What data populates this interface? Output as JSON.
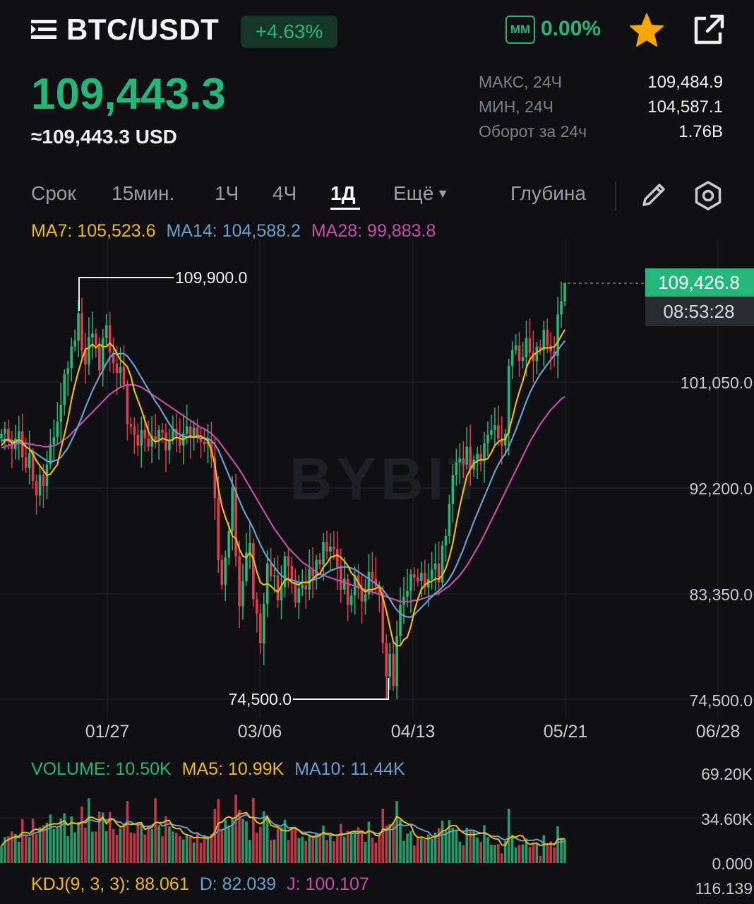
{
  "header": {
    "pair": "BTC/USDT",
    "change_pct": "+4.63%",
    "mm_label": "MM",
    "mm_value": "0.00%",
    "menu_icon": "menu-icon",
    "favorite_icon": "star-icon",
    "share_icon": "share-icon",
    "accent_green": "#25b77a",
    "star_color": "#f7a600"
  },
  "price": {
    "last": "109,443.3",
    "usd": "≈109,443.3 USD"
  },
  "stats": [
    {
      "label": "МАКС, 24Ч",
      "value": "109,484.9"
    },
    {
      "label": "МИН, 24Ч",
      "value": "104,587.1"
    },
    {
      "label": "Оборот за 24ч",
      "value": "1.76B"
    }
  ],
  "tabs": [
    {
      "label": "Срок",
      "active": false
    },
    {
      "label": "15мин.",
      "active": false
    },
    {
      "label": "1Ч",
      "active": false
    },
    {
      "label": "4Ч",
      "active": false
    },
    {
      "label": "1Д",
      "active": true
    },
    {
      "label": "Ещё",
      "active": false
    },
    {
      "label": "Глубина",
      "active": false
    }
  ],
  "ma_legend": {
    "ma7": "MA7: 105,523.6",
    "ma14": "MA14: 104,588.2",
    "ma28": "MA28: 99,883.8",
    "ma7_color": "#f0b90b",
    "ma14_color": "#6a9fc9",
    "ma28_color": "#c34fa8"
  },
  "volume_legend": {
    "volume": "VOLUME: 10.50K",
    "ma5": "MA5: 10.99K",
    "ma10": "MA10: 11.44K"
  },
  "kdj_legend": {
    "k": "KDJ(9, 3, 3): 88.061",
    "d": "D: 82.039",
    "j": "J: 100.107"
  },
  "watermark": "BYBIT",
  "chart_data": {
    "type": "candlestick",
    "y_ticks": [
      "101,050.0",
      "92,200.0",
      "83,350.0",
      "74,500.0"
    ],
    "y_range": [
      74500,
      109900
    ],
    "x_ticks": [
      "01/27",
      "03/06",
      "04/13",
      "05/21",
      "06/28"
    ],
    "high_marker": "109,900.0",
    "low_marker": "74,500.0",
    "current_price": "109,426.8",
    "countdown": "08:53:28",
    "volume_ticks": [
      "69.20K",
      "34.60K",
      "0.000"
    ],
    "kdj_tick": "116.139",
    "up_color": "#25b77a",
    "down_color": "#e03e4d",
    "close_series": [
      96800,
      97200,
      96100,
      95500,
      96400,
      97000,
      94800,
      93900,
      95200,
      92800,
      91600,
      93300,
      92400,
      94200,
      95900,
      96500,
      97800,
      99200,
      101800,
      102300,
      104100,
      104600,
      106900,
      103800,
      102600,
      104900,
      105200,
      104300,
      102100,
      104800,
      105900,
      103600,
      102700,
      101900,
      102400,
      100900,
      97600,
      97400,
      96700,
      95800,
      97100,
      96400,
      95700,
      96600,
      96200,
      97100,
      96900,
      95400,
      96300,
      97200,
      96600,
      95800,
      96800,
      97400,
      96500,
      97300,
      96400,
      96100,
      95900,
      96300,
      94800,
      91400,
      86200,
      84100,
      86400,
      88600,
      92300,
      86500,
      82300,
      84400,
      86800,
      87600,
      82900,
      81700,
      79200,
      82500,
      85900,
      84800,
      84900,
      82800,
      83900,
      86500,
      85700,
      84500,
      82600,
      83800,
      84100,
      83700,
      85400,
      84800,
      86200,
      85800,
      87700,
      86900,
      87300,
      87100,
      85500,
      83700,
      84600,
      82400,
      83200,
      84900,
      83800,
      82700,
      83300,
      85200,
      84600,
      84000,
      83400,
      79200,
      76400,
      78300,
      75600,
      79800,
      82400,
      83100,
      83600,
      85000,
      84700,
      84400,
      85100,
      83900,
      84600,
      85400,
      85900,
      84300,
      87400,
      88200,
      90900,
      93300,
      94400,
      94700,
      94200,
      95700,
      93800,
      94600,
      95100,
      94500,
      96000,
      96700,
      97100,
      97500,
      96400,
      95800,
      96800,
      102500,
      103800,
      104200,
      102900,
      103200,
      104800,
      103600,
      102900,
      104100,
      103800,
      105500,
      104200,
      103700,
      103300,
      106800,
      107900,
      109426.8
    ],
    "ma7_series": [
      95800,
      96200,
      96300,
      96000,
      96100,
      96300,
      96100,
      95700,
      95500,
      95100,
      94500,
      94100,
      93700,
      93300,
      93400,
      93800,
      94200,
      95500,
      96700,
      98000,
      99600,
      100900,
      102000,
      103000,
      103900,
      104000,
      104300,
      104000,
      104300,
      104100,
      104100,
      104400,
      104100,
      103500,
      103000,
      102700,
      102400,
      101600,
      100400,
      99600,
      98800,
      97900,
      97000,
      96400,
      96100,
      96200,
      96400,
      96300,
      96200,
      96300,
      96500,
      96400,
      96300,
      96500,
      96600,
      96500,
      96600,
      96600,
      96400,
      96200,
      95400,
      94200,
      92200,
      90700,
      89800,
      89000,
      88200,
      88000,
      87100,
      86500,
      86400,
      86800,
      86300,
      85200,
      84300,
      84100,
      84200,
      84000,
      83700,
      83500,
      84000,
      84500,
      84600,
      84300,
      84200,
      84100,
      84300,
      84300,
      84300,
      84600,
      84900,
      85000,
      85600,
      85900,
      86400,
      86500,
      86600,
      86400,
      86100,
      85700,
      85100,
      84800,
      84300,
      83800,
      83500,
      83700,
      83700,
      83800,
      84000,
      83000,
      81900,
      80600,
      79300,
      79000,
      79000,
      79500,
      79700,
      80600,
      81900,
      82900,
      83700,
      84100,
      84300,
      84400,
      84600,
      84600,
      84900,
      85500,
      86400,
      87600,
      89200,
      90700,
      92000,
      93200,
      93800,
      94300,
      94500,
      94600,
      94600,
      94700,
      95200,
      95800,
      96100,
      96300,
      96300,
      97000,
      98100,
      99300,
      100300,
      101200,
      102300,
      103000,
      103400,
      103600,
      103800,
      104000,
      104000,
      104000,
      104100,
      104500,
      105000,
      105523.6
    ],
    "ma14_series": [
      96200,
      96300,
      96300,
      96200,
      96100,
      96100,
      95900,
      95700,
      95500,
      95300,
      95100,
      94900,
      94700,
      94500,
      94400,
      94500,
      94600,
      94800,
      95200,
      95600,
      96200,
      96800,
      97500,
      98200,
      99000,
      99700,
      100400,
      101000,
      101600,
      102100,
      102700,
      103200,
      103500,
      103500,
      103500,
      103500,
      103300,
      102900,
      102500,
      102000,
      101500,
      101000,
      100500,
      100000,
      99500,
      99100,
      98600,
      98100,
      97600,
      97200,
      96900,
      96700,
      96600,
      96500,
      96500,
      96500,
      96500,
      96400,
      96400,
      96400,
      96200,
      95900,
      95400,
      94700,
      94000,
      93300,
      92600,
      91900,
      91200,
      90500,
      89900,
      89400,
      88800,
      88100,
      87500,
      86900,
      86400,
      86000,
      85600,
      85200,
      84900,
      84700,
      84600,
      84500,
      84400,
      84300,
      84300,
      84300,
      84400,
      84500,
      84600,
      84700,
      84900,
      85100,
      85300,
      85400,
      85500,
      85600,
      85600,
      85600,
      85500,
      85400,
      85200,
      85000,
      84800,
      84600,
      84400,
      84200,
      84000,
      83700,
      83300,
      82900,
      82400,
      82000,
      81700,
      81500,
      81400,
      81400,
      81600,
      81900,
      82200,
      82500,
      82800,
      83100,
      83400,
      83600,
      83900,
      84200,
      84600,
      85100,
      85700,
      86400,
      87100,
      87900,
      88600,
      89400,
      90100,
      90800,
      91500,
      92200,
      92900,
      93600,
      94200,
      94700,
      95100,
      95700,
      96400,
      97100,
      97900,
      98700,
      99500,
      100200,
      100800,
      101300,
      101800,
      102200,
      102600,
      103000,
      103400,
      103800,
      104200,
      104588.2
    ],
    "ma28_series": [
      95600,
      95700,
      95800,
      95900,
      95900,
      96000,
      96000,
      96000,
      95900,
      95900,
      95800,
      95800,
      95700,
      95700,
      95700,
      95800,
      95900,
      96100,
      96300,
      96500,
      96800,
      97100,
      97400,
      97700,
      98000,
      98300,
      98600,
      98900,
      99200,
      99500,
      99800,
      100100,
      100300,
      100500,
      100700,
      100800,
      100900,
      100900,
      100900,
      100800,
      100700,
      100500,
      100300,
      100100,
      99900,
      99700,
      99500,
      99300,
      99100,
      98900,
      98700,
      98500,
      98300,
      98100,
      97900,
      97700,
      97500,
      97300,
      97200,
      97000,
      96800,
      96500,
      96200,
      95800,
      95400,
      95000,
      94600,
      94200,
      93800,
      93300,
      92800,
      92300,
      91800,
      91300,
      90800,
      90300,
      89800,
      89300,
      88800,
      88400,
      88000,
      87600,
      87200,
      86900,
      86600,
      86300,
      86000,
      85800,
      85600,
      85400,
      85200,
      85000,
      84900,
      84800,
      84700,
      84600,
      84500,
      84400,
      84300,
      84200,
      84100,
      84000,
      83900,
      83800,
      83700,
      83600,
      83500,
      83400,
      83300,
      83200,
      83100,
      83000,
      82900,
      82800,
      82700,
      82700,
      82700,
      82700,
      82800,
      82800,
      82900,
      83000,
      83100,
      83200,
      83300,
      83400,
      83600,
      83800,
      84000,
      84300,
      84600,
      84900,
      85300,
      85700,
      86200,
      86700,
      87200,
      87700,
      88300,
      88900,
      89500,
      90100,
      90700,
      91300,
      91900,
      92500,
      93100,
      93700,
      94300,
      94900,
      95500,
      96100,
      96600,
      97100,
      97600,
      98000,
      98400,
      98800,
      99100,
      99400,
      99700,
      99883.8
    ]
  }
}
